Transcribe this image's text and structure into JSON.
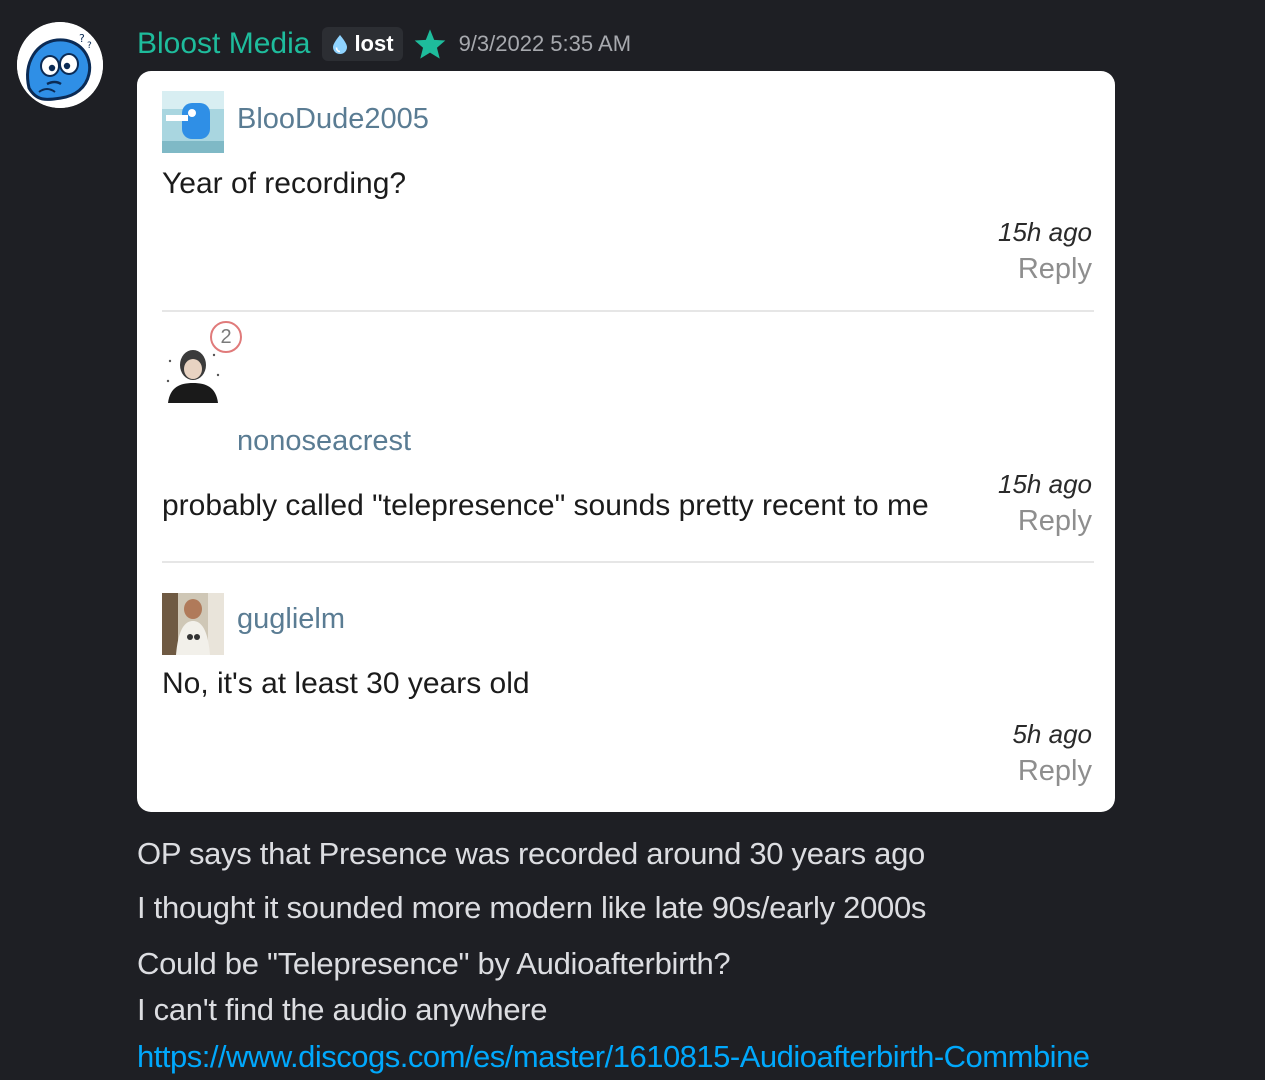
{
  "message": {
    "author": "Bloost Media",
    "role_tag": "lost",
    "timestamp": "9/3/2022 5:35 AM",
    "colors": {
      "author": "#1ebc9c",
      "star": "#1ebc9c",
      "link": "#00a8fc",
      "background": "#1e1f24"
    },
    "icons": {
      "avatar": "blue-blob-avatar",
      "role": "water-drop-icon",
      "badge": "star-icon"
    },
    "embed": {
      "comments": [
        {
          "author": "BlooDude2005",
          "text": "Year of recording?",
          "time": "15h ago",
          "reply": "Reply"
        },
        {
          "author": "nonoseacrest",
          "badge_count": "2",
          "text": "probably called \"telepresence\" sounds pretty recent to me",
          "time": "15h ago",
          "reply": "Reply"
        },
        {
          "author": "guglielm",
          "text": "No, it's at least 30 years old",
          "time": "5h ago",
          "reply": "Reply"
        }
      ]
    },
    "lines": [
      "OP says that Presence was recorded around 30 years ago",
      "I thought it sounded more modern like late 90s/early 2000s",
      "Could be \"Telepresence\" by Audioafterbirth?",
      "I can't find the audio anywhere"
    ],
    "link": "https://www.discogs.com/es/master/1610815-Audioafterbirth-Commbine"
  }
}
